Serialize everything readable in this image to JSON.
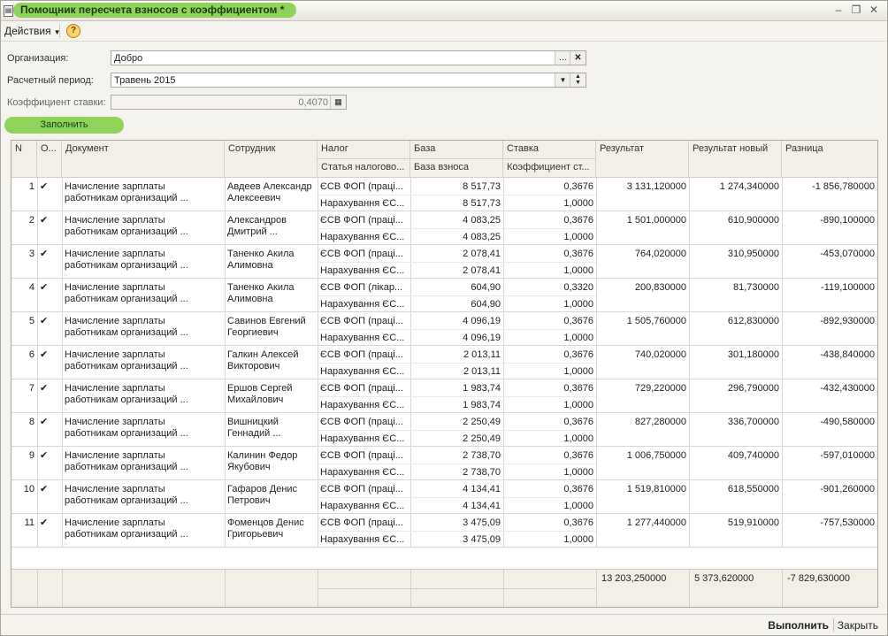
{
  "window": {
    "title": "Помощник пересчета взносов с коэффициентом *"
  },
  "toolbar": {
    "actions_label": "Действия",
    "help": "?"
  },
  "form": {
    "org_label": "Организация:",
    "org_value": "Добро",
    "period_label": "Расчетный период:",
    "period_value": "Травень 2015",
    "coef_label": "Коэффициент ставки:",
    "coef_value": "0,4070",
    "fill_button": "Заполнить"
  },
  "table": {
    "headers": {
      "n": "N",
      "o": "О...",
      "doc": "Документ",
      "emp": "Сотрудник",
      "tax": "Налог",
      "tax2": "Статья налогово...",
      "base": "База",
      "base2": "База взноса",
      "rate": "Ставка",
      "rate2": "Коэффициент ст...",
      "res": "Результат",
      "resnew": "Результат новый",
      "diff": "Разница"
    },
    "rows": [
      {
        "n": "1",
        "check": "✔",
        "doc1": "Начисление зарплаты",
        "doc2": "работникам организаций ...",
        "emp1": "Авдеев Александр",
        "emp2": "Алексеевич",
        "tax": "ЄСВ ФОП (праці...",
        "tax2": "Нарахування ЄС...",
        "base": "8 517,73",
        "base2": "8 517,73",
        "rate": "0,3676",
        "rate2": "1,0000",
        "res": "3 131,120000",
        "resnew": "1 274,340000",
        "diff": "-1 856,780000"
      },
      {
        "n": "2",
        "check": "✔",
        "doc1": "Начисление зарплаты",
        "doc2": "работникам организаций ...",
        "emp1": "Александров",
        "emp2": "Дмитрий ...",
        "tax": "ЄСВ ФОП (праці...",
        "tax2": "Нарахування ЄС...",
        "base": "4 083,25",
        "base2": "4 083,25",
        "rate": "0,3676",
        "rate2": "1,0000",
        "res": "1 501,000000",
        "resnew": "610,900000",
        "diff": "-890,100000"
      },
      {
        "n": "3",
        "check": "✔",
        "doc1": "Начисление зарплаты",
        "doc2": "работникам организаций ...",
        "emp1": "Таненко Акила",
        "emp2": "Алимовна",
        "tax": "ЄСВ ФОП (праці...",
        "tax2": "Нарахування ЄС...",
        "base": "2 078,41",
        "base2": "2 078,41",
        "rate": "0,3676",
        "rate2": "1,0000",
        "res": "764,020000",
        "resnew": "310,950000",
        "diff": "-453,070000"
      },
      {
        "n": "4",
        "check": "✔",
        "doc1": "Начисление зарплаты",
        "doc2": "работникам организаций ...",
        "emp1": "Таненко Акила",
        "emp2": "Алимовна",
        "tax": "ЄСВ ФОП (лікар...",
        "tax2": "Нарахування ЄС...",
        "base": "604,90",
        "base2": "604,90",
        "rate": "0,3320",
        "rate2": "1,0000",
        "res": "200,830000",
        "resnew": "81,730000",
        "diff": "-119,100000"
      },
      {
        "n": "5",
        "check": "✔",
        "doc1": "Начисление зарплаты",
        "doc2": "работникам организаций ...",
        "emp1": "Савинов Евгений",
        "emp2": "Георгиевич",
        "tax": "ЄСВ ФОП (праці...",
        "tax2": "Нарахування ЄС...",
        "base": "4 096,19",
        "base2": "4 096,19",
        "rate": "0,3676",
        "rate2": "1,0000",
        "res": "1 505,760000",
        "resnew": "612,830000",
        "diff": "-892,930000"
      },
      {
        "n": "6",
        "check": "✔",
        "doc1": "Начисление зарплаты",
        "doc2": "работникам организаций ...",
        "emp1": "Галкин Алексей",
        "emp2": "Викторович",
        "tax": "ЄСВ ФОП (праці...",
        "tax2": "Нарахування ЄС...",
        "base": "2 013,11",
        "base2": "2 013,11",
        "rate": "0,3676",
        "rate2": "1,0000",
        "res": "740,020000",
        "resnew": "301,180000",
        "diff": "-438,840000"
      },
      {
        "n": "7",
        "check": "✔",
        "doc1": "Начисление зарплаты",
        "doc2": "работникам организаций ...",
        "emp1": "Ершов Сергей",
        "emp2": "Михайлович",
        "tax": "ЄСВ ФОП (праці...",
        "tax2": "Нарахування ЄС...",
        "base": "1 983,74",
        "base2": "1 983,74",
        "rate": "0,3676",
        "rate2": "1,0000",
        "res": "729,220000",
        "resnew": "296,790000",
        "diff": "-432,430000"
      },
      {
        "n": "8",
        "check": "✔",
        "doc1": "Начисление зарплаты",
        "doc2": "работникам организаций ...",
        "emp1": "Вишницкий",
        "emp2": "Геннадий ...",
        "tax": "ЄСВ ФОП (праці...",
        "tax2": "Нарахування ЄС...",
        "base": "2 250,49",
        "base2": "2 250,49",
        "rate": "0,3676",
        "rate2": "1,0000",
        "res": "827,280000",
        "resnew": "336,700000",
        "diff": "-490,580000"
      },
      {
        "n": "9",
        "check": "✔",
        "doc1": "Начисление зарплаты",
        "doc2": "работникам организаций ...",
        "emp1": "Калинин Федор",
        "emp2": "Якубович",
        "tax": "ЄСВ ФОП (праці...",
        "tax2": "Нарахування ЄС...",
        "base": "2 738,70",
        "base2": "2 738,70",
        "rate": "0,3676",
        "rate2": "1,0000",
        "res": "1 006,750000",
        "resnew": "409,740000",
        "diff": "-597,010000"
      },
      {
        "n": "10",
        "check": "✔",
        "doc1": "Начисление зарплаты",
        "doc2": "работникам организаций ...",
        "emp1": "Гафаров Денис",
        "emp2": "Петрович",
        "tax": "ЄСВ ФОП (праці...",
        "tax2": "Нарахування ЄС...",
        "base": "4 134,41",
        "base2": "4 134,41",
        "rate": "0,3676",
        "rate2": "1,0000",
        "res": "1 519,810000",
        "resnew": "618,550000",
        "diff": "-901,260000"
      },
      {
        "n": "11",
        "check": "✔",
        "doc1": "Начисление зарплаты",
        "doc2": "работникам организаций ...",
        "emp1": "Фоменцов Денис",
        "emp2": "Григорьевич",
        "tax": "ЄСВ ФОП (праці...",
        "tax2": "Нарахування ЄС...",
        "base": "3 475,09",
        "base2": "3 475,09",
        "rate": "0,3676",
        "rate2": "1,0000",
        "res": "1 277,440000",
        "resnew": "519,910000",
        "diff": "-757,530000"
      }
    ],
    "totals": {
      "res": "13 203,250000",
      "resnew": "5 373,620000",
      "diff": "-7 829,630000"
    }
  },
  "bottom": {
    "execute": "Выполнить",
    "close": "Закрыть"
  }
}
